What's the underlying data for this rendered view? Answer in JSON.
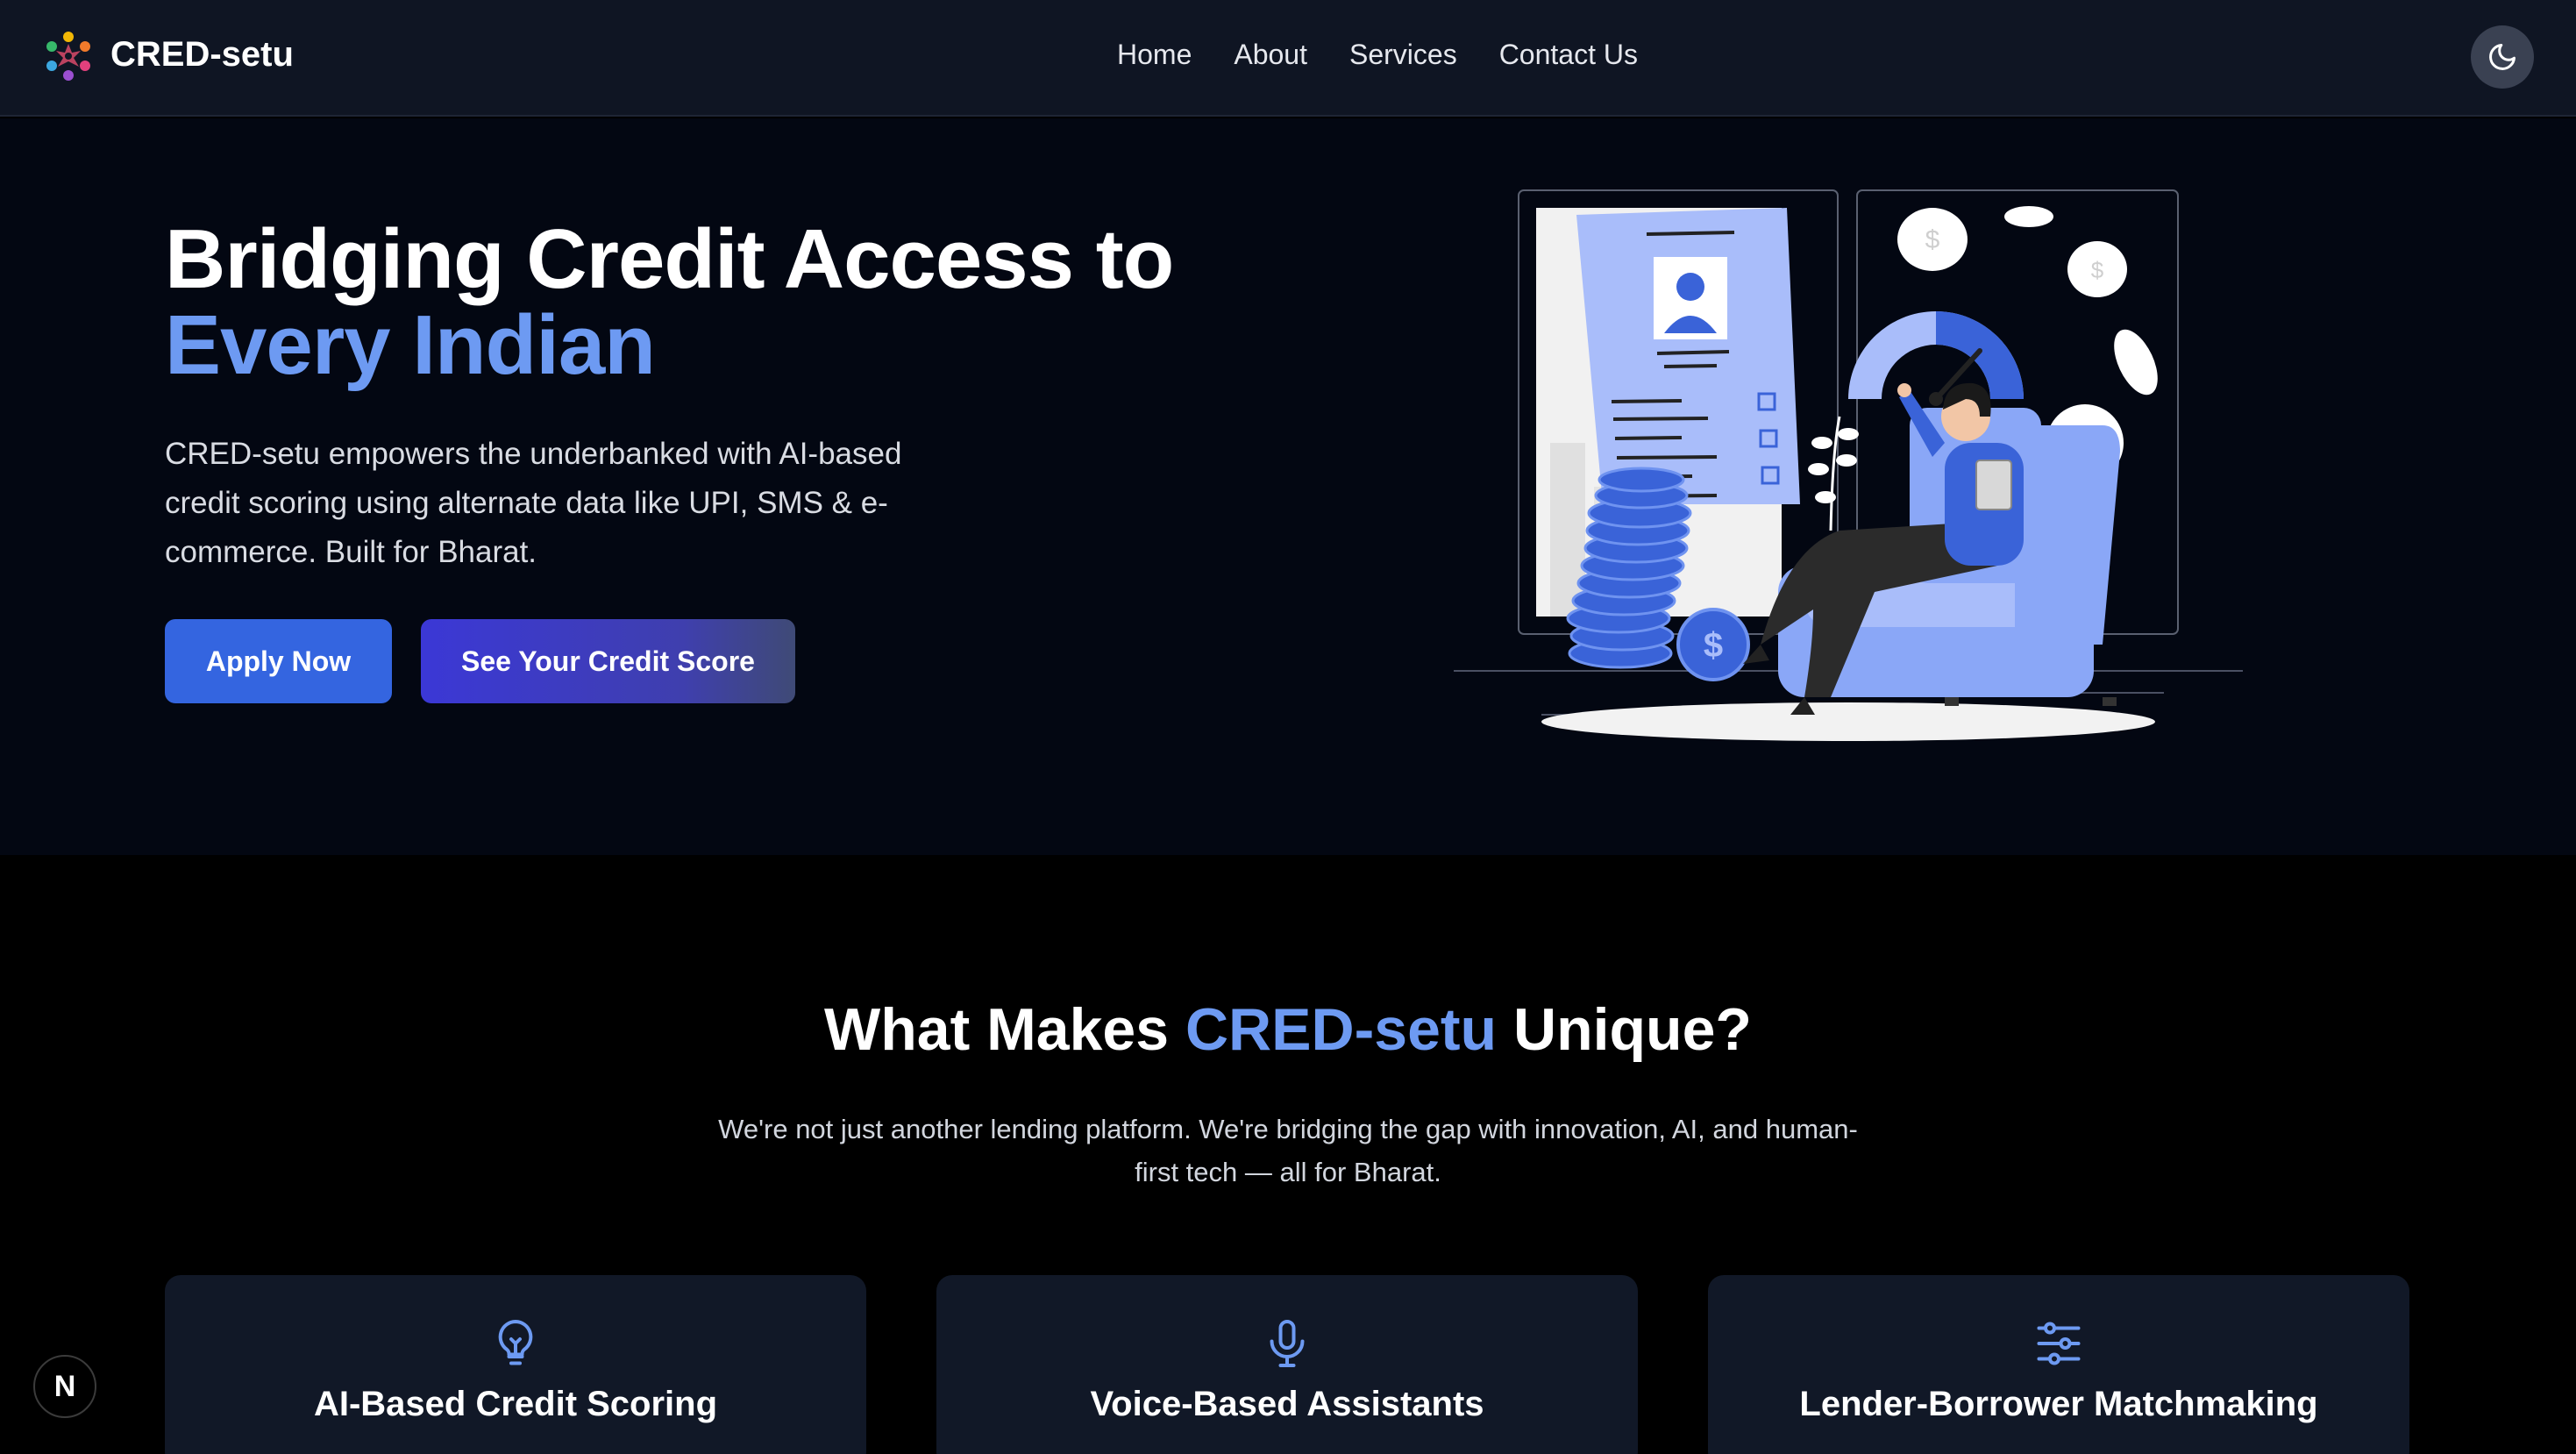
{
  "navbar": {
    "brand": "CRED-setu",
    "links": [
      {
        "label": "Home"
      },
      {
        "label": "About"
      },
      {
        "label": "Services"
      },
      {
        "label": "Contact Us"
      }
    ],
    "theme_toggle_icon": "moon-icon"
  },
  "hero": {
    "title_line1": "Bridging Credit Access to",
    "title_line2": "Every Indian",
    "description": "CRED-setu empowers the underbanked with AI-based credit scoring using alternate data like UPI, SMS & e-commerce. Built for Bharat.",
    "apply_button": "Apply Now",
    "score_button": "See Your Credit Score"
  },
  "features": {
    "title_prefix": "What Makes ",
    "title_accent": "CRED-setu",
    "title_suffix": " Unique?",
    "description": "We're not just another lending platform. We're bridging the gap with innovation, AI, and human-first tech — all for Bharat.",
    "cards": [
      {
        "icon": "lightbulb-icon",
        "title": "AI-Based Credit Scoring"
      },
      {
        "icon": "microphone-icon",
        "title": "Voice-Based Assistants"
      },
      {
        "icon": "sliders-icon",
        "title": "Lender-Borrower Matchmaking"
      }
    ]
  },
  "dev_badge": "N",
  "colors": {
    "accent": "#6d9af2",
    "primary_button": "#3465e0",
    "navbar_bg": "#0f1523",
    "hero_bg": "#030712",
    "card_bg": "#111827"
  }
}
